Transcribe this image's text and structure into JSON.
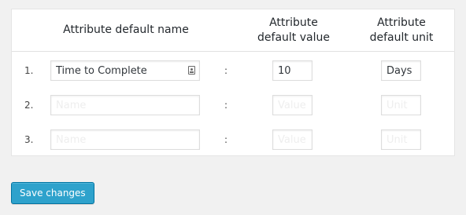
{
  "table": {
    "headers": {
      "name": "Attribute default name",
      "value": "Attribute\ndefault value",
      "unit": "Attribute\ndefault unit"
    },
    "separator": ":",
    "rows": [
      {
        "number": "1.",
        "name": "Time to Complete",
        "value": "10",
        "unit": "Days",
        "name_placeholder": "",
        "value_placeholder": "",
        "unit_placeholder": ""
      },
      {
        "number": "2.",
        "name": "",
        "value": "",
        "unit": "",
        "name_placeholder": "Name",
        "value_placeholder": "Value",
        "unit_placeholder": "Unit"
      },
      {
        "number": "3.",
        "name": "",
        "value": "",
        "unit": "",
        "name_placeholder": "Name",
        "value_placeholder": "Value",
        "unit_placeholder": "Unit"
      }
    ]
  },
  "actions": {
    "save_label": "Save changes"
  },
  "icons": {
    "name_field_icon": "contact-card-icon"
  }
}
